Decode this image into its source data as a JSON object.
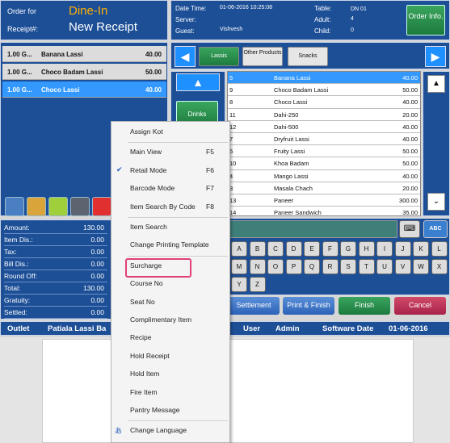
{
  "header": {
    "order_for_label": "Order for",
    "order_type": "Dine-In",
    "receipt_label": "Receipt#:",
    "receipt_value": "New Receipt"
  },
  "info": {
    "date_label": "Date Time:",
    "date_value": "01-06-2016 10:25:08",
    "server_label": "Server:",
    "guest_label": "Guest:",
    "guest_value": "Vishvesh",
    "table_label": "Table:",
    "table_value": "DN 01",
    "adult_label": "Adult:",
    "adult_value": "4",
    "child_label": "Child:",
    "child_value": "0",
    "order_info_label": "Order Info."
  },
  "order_lines": [
    {
      "qty": "1.00 G...",
      "name": "Banana Lassi",
      "amount": "40.00"
    },
    {
      "qty": "1.00 G...",
      "name": "Choco Badam Lassi",
      "amount": "50.00"
    },
    {
      "qty": "1.00 G...",
      "name": "Choco Lassi",
      "amount": "40.00"
    }
  ],
  "totals": [
    {
      "k": "Amount:",
      "v": "130.00"
    },
    {
      "k": "Item Dis.:",
      "v": "0.00"
    },
    {
      "k": "Tax:",
      "v": "0.00"
    },
    {
      "k": "Bill Dis.:",
      "v": "0.00"
    },
    {
      "k": "Round Off:",
      "v": "0.00"
    },
    {
      "k": "Total:",
      "v": "130.00"
    },
    {
      "k": "Gratuity:",
      "v": "0.00"
    },
    {
      "k": "Settled:",
      "v": "0.00"
    }
  ],
  "categories": [
    "Lassis",
    "Other Products",
    "Snacks"
  ],
  "group_button": "Drinks",
  "items": [
    {
      "code": "5",
      "name": "Banana Lassi",
      "price": "40.00"
    },
    {
      "code": "9",
      "name": "Choco Badam Lassi",
      "price": "50.00"
    },
    {
      "code": "8",
      "name": "Choco Lassi",
      "price": "40.00"
    },
    {
      "code": "11",
      "name": "Dahi-250",
      "price": "20.00"
    },
    {
      "code": "12",
      "name": "Dahi-500",
      "price": "40.00"
    },
    {
      "code": "7",
      "name": "Dryfruit Lassi",
      "price": "40.00"
    },
    {
      "code": "6",
      "name": "Fruity Lassi",
      "price": "50.00"
    },
    {
      "code": "10",
      "name": "Khoa Badam",
      "price": "50.00"
    },
    {
      "code": "4",
      "name": "Mango Lassi",
      "price": "40.00"
    },
    {
      "code": "3",
      "name": "Masala Chach",
      "price": "20.00"
    },
    {
      "code": "13",
      "name": "Paneer",
      "price": "300.00"
    },
    {
      "code": "14",
      "name": "Paneer Sandwich",
      "price": "35.00"
    }
  ],
  "keys_row1": [
    "A",
    "B",
    "C",
    "D",
    "E",
    "F",
    "G",
    "H",
    "I",
    "J",
    "K",
    "L"
  ],
  "keys_row2": [
    "M",
    "N",
    "O",
    "P",
    "Q",
    "R",
    "S",
    "T",
    "U",
    "V",
    "W",
    "X"
  ],
  "keys_row3": [
    "Y",
    "Z"
  ],
  "abc_label": "ABC",
  "actions": {
    "settlement": "Settlement",
    "print_finish": "Print & Finish",
    "finish": "Finish",
    "cancel": "Cancel"
  },
  "status": {
    "outlet_label": "Outlet",
    "outlet_value": "Patiala Lassi Ba",
    "user_label": "User",
    "user_value": "Admin",
    "date_label": "Software Date",
    "date_value": "01-06-2016"
  },
  "menu": {
    "items": [
      {
        "label": "Assign Kot",
        "shortcut": ""
      },
      {
        "label": "Main View",
        "shortcut": "F5"
      },
      {
        "label": "Retail Mode",
        "shortcut": "F6"
      },
      {
        "label": "Barcode Mode",
        "shortcut": "F7"
      },
      {
        "label": "Item Search By Code",
        "shortcut": "F8"
      },
      {
        "label": "Item Search",
        "shortcut": ""
      },
      {
        "label": "Change Printing Template",
        "shortcut": ""
      },
      {
        "label": "Surcharge",
        "shortcut": ""
      },
      {
        "label": "Course No",
        "shortcut": ""
      },
      {
        "label": "Seat No",
        "shortcut": ""
      },
      {
        "label": "Complimentary Item",
        "shortcut": ""
      },
      {
        "label": "Recipe",
        "shortcut": ""
      },
      {
        "label": "Hold Receipt",
        "shortcut": ""
      },
      {
        "label": "Hold Item",
        "shortcut": ""
      },
      {
        "label": "Fire Item",
        "shortcut": ""
      },
      {
        "label": "Pantry Message",
        "shortcut": ""
      },
      {
        "label": "Change Language",
        "shortcut": ""
      }
    ],
    "checked_item": "Retail Mode",
    "highlighted_item": "Surcharge"
  }
}
